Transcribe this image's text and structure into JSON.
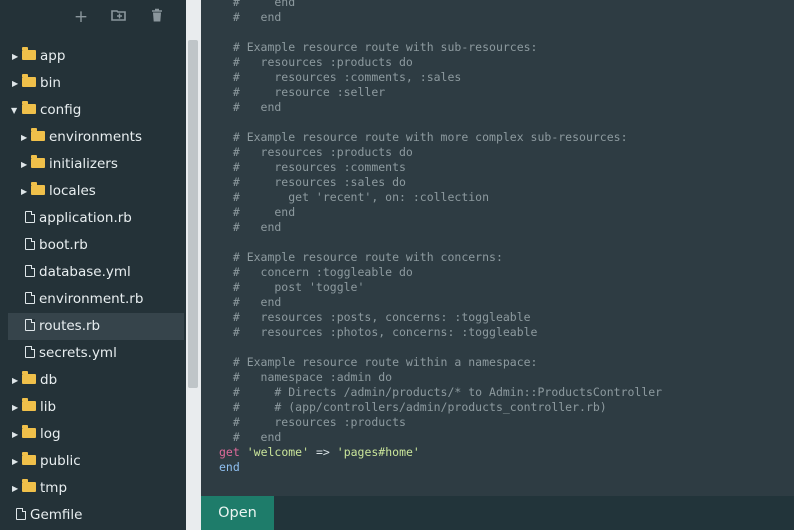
{
  "toolbar": {
    "new_icon": "plus-icon",
    "new_folder_icon": "folder-plus-icon",
    "delete_icon": "trash-icon"
  },
  "tree": [
    {
      "label": "app",
      "type": "folder",
      "expanded": false
    },
    {
      "label": "bin",
      "type": "folder",
      "expanded": false
    },
    {
      "label": "config",
      "type": "folder",
      "expanded": true
    },
    {
      "label": "environments",
      "type": "folder",
      "expanded": false
    },
    {
      "label": "initializers",
      "type": "folder",
      "expanded": false
    },
    {
      "label": "locales",
      "type": "folder",
      "expanded": false
    },
    {
      "label": "application.rb",
      "type": "file"
    },
    {
      "label": "boot.rb",
      "type": "file"
    },
    {
      "label": "database.yml",
      "type": "file"
    },
    {
      "label": "environment.rb",
      "type": "file"
    },
    {
      "label": "routes.rb",
      "type": "file",
      "selected": true
    },
    {
      "label": "secrets.yml",
      "type": "file"
    },
    {
      "label": "db",
      "type": "folder",
      "expanded": false
    },
    {
      "label": "lib",
      "type": "folder",
      "expanded": false
    },
    {
      "label": "log",
      "type": "folder",
      "expanded": false
    },
    {
      "label": "public",
      "type": "folder",
      "expanded": false
    },
    {
      "label": "tmp",
      "type": "folder",
      "expanded": false
    },
    {
      "label": "Gemfile",
      "type": "file"
    }
  ],
  "editor": {
    "comment_lines": [
      "  #     end",
      "  #   end",
      "",
      "  # Example resource route with sub-resources:",
      "  #   resources :products do",
      "  #     resources :comments, :sales",
      "  #     resource :seller",
      "  #   end",
      "",
      "  # Example resource route with more complex sub-resources:",
      "  #   resources :products do",
      "  #     resources :comments",
      "  #     resources :sales do",
      "  #       get 'recent', on: :collection",
      "  #     end",
      "  #   end",
      "",
      "  # Example resource route with concerns:",
      "  #   concern :toggleable do",
      "  #     post 'toggle'",
      "  #   end",
      "  #   resources :posts, concerns: :toggleable",
      "  #   resources :photos, concerns: :toggleable",
      "",
      "  # Example resource route within a namespace:",
      "  #   namespace :admin do",
      "  #     # Directs /admin/products/* to Admin::ProductsController",
      "  #     # (app/controllers/admin/products_controller.rb)",
      "  #     resources :products",
      "  #   end"
    ],
    "route_keyword": "get",
    "route_from": "'welcome'",
    "route_arrow": "=>",
    "route_to": "'pages#home'",
    "end_keyword": "end"
  },
  "bottom": {
    "open_label": "Open"
  }
}
